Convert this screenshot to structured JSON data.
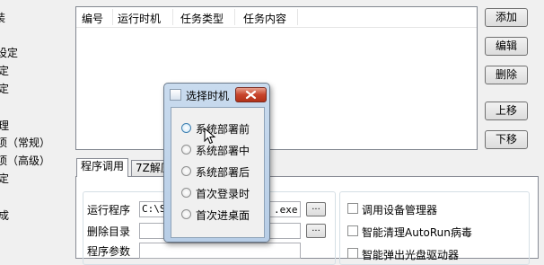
{
  "left_tree": {
    "items": [
      "装",
      "设定",
      "定",
      "定",
      "理",
      "项（常规）",
      "项（高级）",
      "定",
      "成"
    ]
  },
  "task_list": {
    "columns": [
      "编号",
      "运行时机",
      "任务类型",
      "任务内容"
    ]
  },
  "side_buttons": {
    "add": "添加",
    "edit": "编辑",
    "delete": "删除",
    "move_up": "上移",
    "move_down": "下移"
  },
  "tabs": {
    "active": "程序调用",
    "second": "7Z解压"
  },
  "program_panel": {
    "run_program_label": "运行程序",
    "run_program_value": "C:\\S",
    "run_program_ext": ".exe",
    "delete_dir_label": "删除目录",
    "params_label": "程序参数",
    "browse_label": "..."
  },
  "options": {
    "device_manager": "调用设备管理器",
    "autorun_clean": "智能清理AutoRun病毒",
    "clipped_option": "智能弹出光盘驱动器"
  },
  "dialog": {
    "title": "选择时机",
    "options": [
      "系统部署前",
      "系统部署中",
      "系统部署后",
      "首次登录时",
      "首次进桌面"
    ]
  }
}
